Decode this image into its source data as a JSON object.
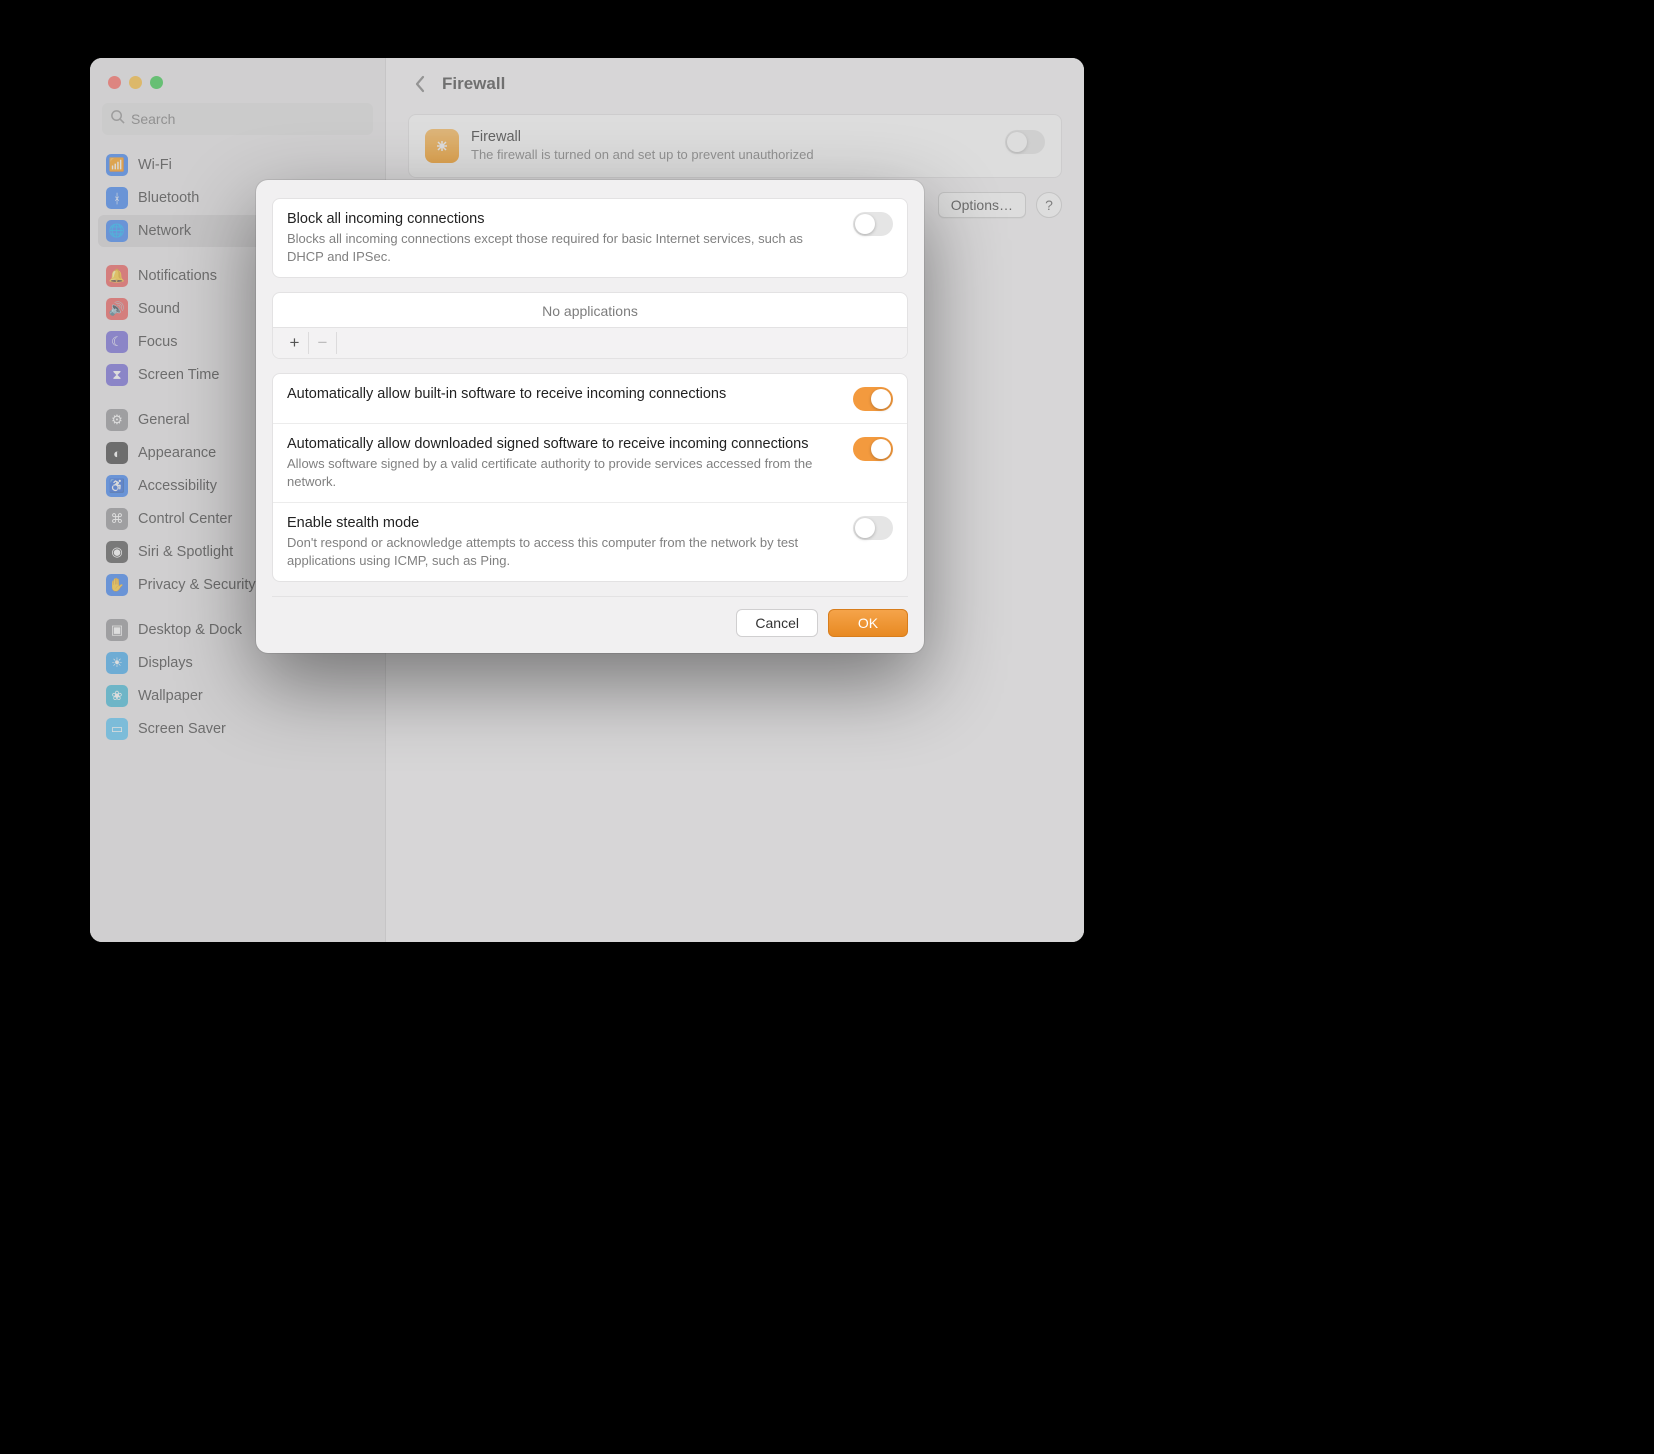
{
  "search": {
    "placeholder": "Search"
  },
  "sidebar": {
    "items": [
      {
        "label": "Wi-Fi",
        "icon": "wifi-icon",
        "color": "#2f7af3"
      },
      {
        "label": "Bluetooth",
        "icon": "bluetooth-icon",
        "color": "#2f7af3"
      },
      {
        "label": "Network",
        "icon": "network-icon",
        "color": "#2f7af3",
        "selected": true
      },
      {
        "spacer": true
      },
      {
        "label": "Notifications",
        "icon": "bell-icon",
        "color": "#ef5350"
      },
      {
        "label": "Sound",
        "icon": "sound-icon",
        "color": "#ef5350"
      },
      {
        "label": "Focus",
        "icon": "moon-icon",
        "color": "#6b5fd8"
      },
      {
        "label": "Screen Time",
        "icon": "hourglass-icon",
        "color": "#6b5fd8"
      },
      {
        "spacer": true
      },
      {
        "label": "General",
        "icon": "gear-icon",
        "color": "#8e8e93"
      },
      {
        "label": "Appearance",
        "icon": "appearance-icon",
        "color": "#333333"
      },
      {
        "label": "Accessibility",
        "icon": "accessibility-icon",
        "color": "#2f7af3"
      },
      {
        "label": "Control Center",
        "icon": "control-center-icon",
        "color": "#8e8e93"
      },
      {
        "label": "Siri & Spotlight",
        "icon": "siri-icon",
        "color": "#4a4a4a"
      },
      {
        "label": "Privacy & Security",
        "icon": "hand-icon",
        "color": "#2f7af3"
      },
      {
        "spacer": true
      },
      {
        "label": "Desktop & Dock",
        "icon": "desktop-icon",
        "color": "#8e8e93"
      },
      {
        "label": "Displays",
        "icon": "displays-icon",
        "color": "#36a7ef"
      },
      {
        "label": "Wallpaper",
        "icon": "wallpaper-icon",
        "color": "#36b7d7"
      },
      {
        "label": "Screen Saver",
        "icon": "screensaver-icon",
        "color": "#4fc3f7"
      }
    ]
  },
  "main": {
    "title": "Firewall",
    "firewall": {
      "label": "Firewall",
      "desc": "The firewall is turned on and set up to prevent unauthorized"
    },
    "options_label": "Options…",
    "help_label": "?"
  },
  "modal": {
    "block_all": {
      "title": "Block all incoming connections",
      "desc": "Blocks all incoming connections except those required for basic Internet services, such as DHCP and IPSec.",
      "on": false
    },
    "apps": {
      "empty_label": "No applications",
      "add_label": "+",
      "remove_label": "−"
    },
    "builtin": {
      "title": "Automatically allow built-in software to receive incoming connections",
      "on": true
    },
    "signed": {
      "title": "Automatically allow downloaded signed software to receive incoming connections",
      "desc": "Allows software signed by a valid certificate authority to provide services accessed from the network.",
      "on": true
    },
    "stealth": {
      "title": "Enable stealth mode",
      "desc": "Don't respond or acknowledge attempts to access this computer from the network by test applications using ICMP, such as Ping.",
      "on": false
    },
    "cancel_label": "Cancel",
    "ok_label": "OK"
  }
}
